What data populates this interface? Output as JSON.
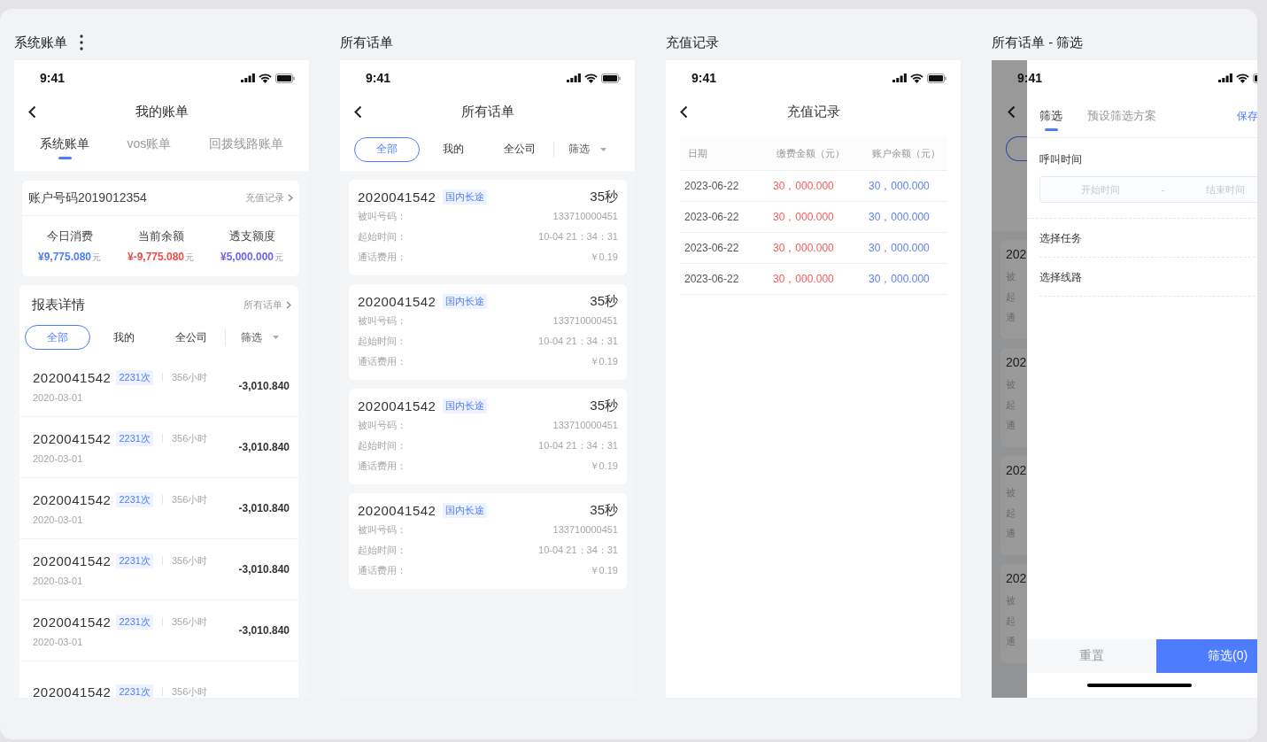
{
  "boards": [
    {
      "kind": "bill",
      "title": "系统账单",
      "menu": true,
      "status_time": "9:41",
      "nav_title": "我的账单",
      "tabs": [
        {
          "label": "系统账单",
          "selected": true
        },
        {
          "label": "vos账单",
          "selected": false
        },
        {
          "label": "回拨线路账单",
          "selected": false
        }
      ],
      "account": {
        "number": "账户号码2019012354",
        "link": "充值记录"
      },
      "stats": [
        {
          "label": "今日消费",
          "value": "¥9,775.080",
          "unit": "元",
          "color": "#4d7cfe"
        },
        {
          "label": "当前余额",
          "value": "¥-9,775.080",
          "unit": "元",
          "color": "#f04b4b"
        },
        {
          "label": "透支额度",
          "value": "¥5,000.000",
          "unit": "元",
          "color": "#7062f0"
        }
      ],
      "report": {
        "title": "报表详情",
        "link": "所有话单",
        "filter_button": "筛选",
        "filters": [
          {
            "label": "全部",
            "selected": true
          },
          {
            "label": "我的",
            "selected": false
          },
          {
            "label": "全公司",
            "selected": false
          }
        ],
        "rows": [
          {
            "number": "2020041542",
            "count": "2231次",
            "hours": "356小时",
            "date": "2020-03-01",
            "amount": "-3,010.840"
          },
          {
            "number": "2020041542",
            "count": "2231次",
            "hours": "356小时",
            "date": "2020-03-01",
            "amount": "-3,010.840"
          },
          {
            "number": "2020041542",
            "count": "2231次",
            "hours": "356小时",
            "date": "2020-03-01",
            "amount": "-3,010.840"
          },
          {
            "number": "2020041542",
            "count": "2231次",
            "hours": "356小时",
            "date": "2020-03-01",
            "amount": "-3,010.840"
          },
          {
            "number": "2020041542",
            "count": "2231次",
            "hours": "356小时",
            "date": "2020-03-01",
            "amount": "-3,010.840"
          },
          {
            "number": "2020041542",
            "count": "2231次",
            "hours": "356小时"
          }
        ]
      }
    },
    {
      "kind": "calls",
      "title": "所有话单",
      "status_time": "9:41",
      "nav_title": "所有话单",
      "filter_button": "筛选",
      "filters": [
        {
          "label": "全部",
          "selected": true
        },
        {
          "label": "我的",
          "selected": false
        },
        {
          "label": "全公司",
          "selected": false
        }
      ],
      "cards": [
        {
          "number": "2020041542",
          "tag": "国内长途",
          "duration": "35秒",
          "fields": [
            {
              "label": "被叫号码：",
              "value": "133710000451"
            },
            {
              "label": "起始时间：",
              "value": "10-04 21：34：31"
            },
            {
              "label": "通话费用：",
              "value": "￥0.19"
            }
          ]
        },
        {
          "number": "2020041542",
          "tag": "国内长途",
          "duration": "35秒",
          "fields": [
            {
              "label": "被叫号码：",
              "value": "133710000451"
            },
            {
              "label": "起始时间：",
              "value": "10-04 21：34：31"
            },
            {
              "label": "通话费用：",
              "value": "￥0.19"
            }
          ]
        },
        {
          "number": "2020041542",
          "tag": "国内长途",
          "duration": "35秒",
          "fields": [
            {
              "label": "被叫号码：",
              "value": "133710000451"
            },
            {
              "label": "起始时间：",
              "value": "10-04 21：34：31"
            },
            {
              "label": "通话费用：",
              "value": "￥0.19"
            }
          ]
        },
        {
          "number": "2020041542",
          "tag": "国内长途",
          "duration": "35秒",
          "fields": [
            {
              "label": "被叫号码：",
              "value": "133710000451"
            },
            {
              "label": "起始时间：",
              "value": "10-04 21：34：31"
            },
            {
              "label": "通话费用：",
              "value": "￥0.19"
            }
          ]
        }
      ]
    },
    {
      "kind": "recharge",
      "title": "充值记录",
      "status_time": "9:41",
      "nav_title": "充值记录",
      "table": {
        "columns": [
          "日期",
          "缴费金额（元）",
          "账户余额（元）"
        ],
        "rows": [
          [
            "2023-06-22",
            "30，000.000",
            "30，000.000"
          ],
          [
            "2023-06-22",
            "30，000.000",
            "30，000.000"
          ],
          [
            "2023-06-22",
            "30，000.000",
            "30，000.000"
          ],
          [
            "2023-06-22",
            "30，000.000",
            "30，000.000"
          ]
        ]
      }
    },
    {
      "kind": "filter",
      "title": "所有话单 - 筛选",
      "status_time": "9:41",
      "background_cards": [
        {
          "number": "202",
          "labels": [
            "被",
            "起",
            "通"
          ]
        },
        {
          "number": "202",
          "labels": [
            "被",
            "起",
            "通"
          ]
        },
        {
          "number": "202",
          "labels": [
            "被",
            "起",
            "通"
          ]
        },
        {
          "number": "202",
          "labels": [
            "被",
            "起",
            "通"
          ]
        }
      ],
      "drawer": {
        "tabs": [
          {
            "label": "筛选",
            "selected": true
          },
          {
            "label": "预设筛选方案",
            "selected": false
          }
        ],
        "save": "保存",
        "sections": [
          {
            "kind": "range",
            "label": "呼叫时间",
            "start_placeholder": "开始时间",
            "separator": "-",
            "end_placeholder": "结束时间"
          },
          {
            "kind": "select",
            "label": "选择任务"
          },
          {
            "kind": "select",
            "label": "选择线路"
          }
        ],
        "reset": "重置",
        "submit": "筛选(0)"
      }
    }
  ]
}
